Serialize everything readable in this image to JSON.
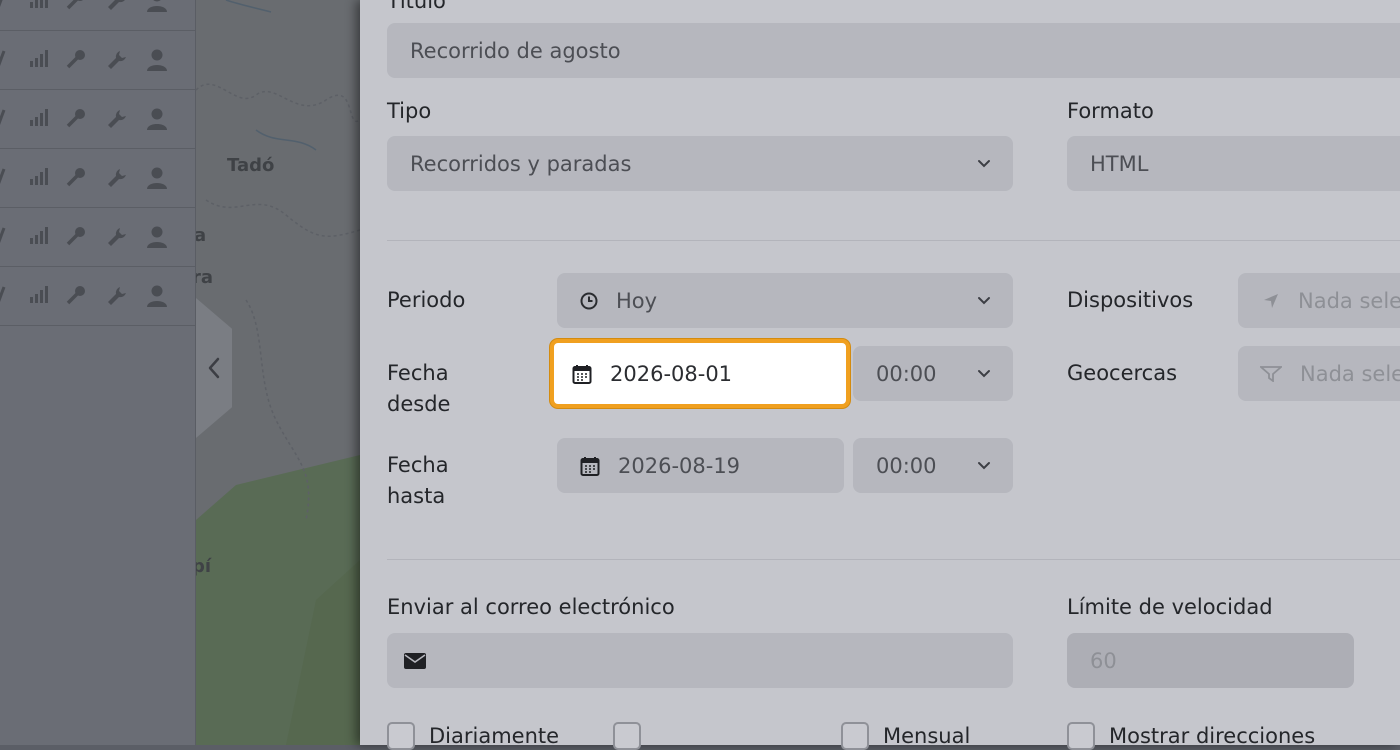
{
  "form": {
    "title_label": "Título",
    "title_value": "Recorrido de agosto",
    "tipo_label": "Tipo",
    "tipo_value": "Recorridos y paradas",
    "formato_label": "Formato",
    "formato_value": "HTML",
    "periodo_label": "Periodo",
    "periodo_value": "Hoy",
    "dispositivos_label": "Dispositivos",
    "dispositivos_placeholder": "Nada selec",
    "fecha_desde_label_1": "Fecha",
    "fecha_desde_label_2": "desde",
    "fecha_desde_value": "2026-08-01",
    "hora_desde_value": "00:00",
    "geocercas_label": "Geocercas",
    "geocercas_placeholder": "Nada selec",
    "fecha_hasta_label_1": "Fecha",
    "fecha_hasta_label_2": "hasta",
    "fecha_hasta_value": "2026-08-19",
    "hora_hasta_value": "00:00",
    "email_label": "Enviar al correo electrónico",
    "email_value": "",
    "speed_label": "Límite de velocidad",
    "speed_placeholder": "60",
    "checkboxes": {
      "daily": "Diariamente",
      "weekly": "",
      "monthly": "Mensual",
      "show_addresses": "Mostrar direcciones"
    }
  },
  "map": {
    "towns": [
      "Tadó",
      "a",
      "ra",
      "pí"
    ]
  },
  "colors": {
    "accent": "#f0a020",
    "modal_bg": "#c5c6cc",
    "field_bg": "#b6b7be"
  }
}
